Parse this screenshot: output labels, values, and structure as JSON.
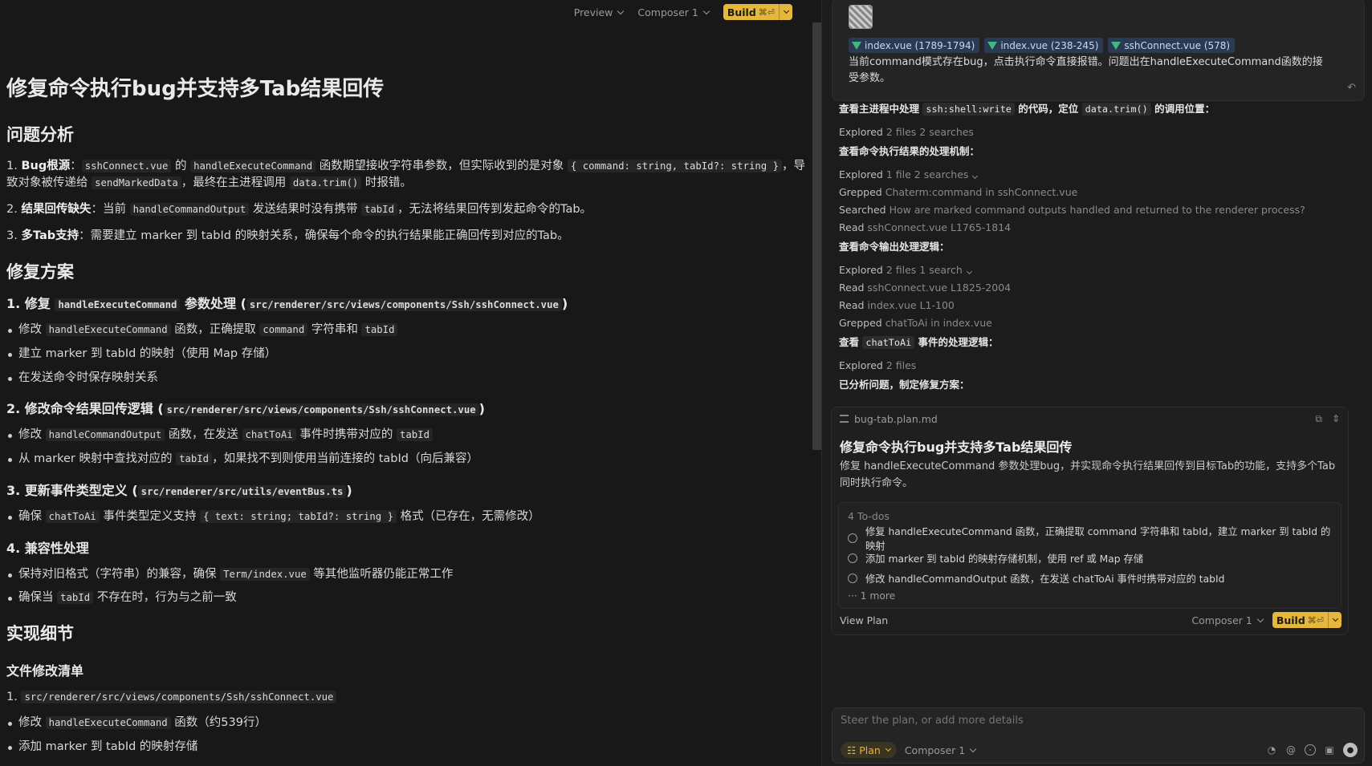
{
  "toolbar": {
    "preview": "Preview",
    "composer": "Composer 1",
    "build": "Build",
    "build_kbd": "⌘⏎"
  },
  "doc": {
    "title": "修复命令执行bug并支持多Tab结果回传",
    "analysis": {
      "heading": "问题分析",
      "items": [
        {
          "n": "1. ",
          "label": "Bug根源",
          "parts": [
            "：",
            "sshConnect.vue",
            " 的 ",
            "handleExecuteCommand",
            " 函数期望接收字符串参数，但实际收到的是对象 ",
            "{ command: string, tabId?: string }",
            "，导致对象被传递给 ",
            "sendMarkedData",
            "，最终在主进程调用 ",
            "data.trim()",
            " 时报错。"
          ]
        },
        {
          "n": "2. ",
          "label": "结果回传缺失",
          "parts": [
            "：当前 ",
            "handleCommandOutput",
            " 发送结果时没有携带 ",
            "tabId",
            "，无法将结果回传到发起命令的Tab。"
          ]
        },
        {
          "n": "3. ",
          "label": "多Tab支持",
          "parts": [
            "：需要建立 marker 到 tabId 的映射关系，确保每个命令的执行结果能正确回传到对应的Tab。"
          ]
        }
      ]
    },
    "plan": {
      "heading": "修复方案",
      "s1": {
        "title": "1. 修复 ",
        "code": "handleExecuteCommand",
        "title2": " 参数处理 (",
        "path": "src/renderer/src/views/components/Ssh/sshConnect.vue",
        "close": ")"
      },
      "s1_items": [
        [
          "修改 ",
          "handleExecuteCommand",
          " 函数，正确提取 ",
          "command",
          " 字符串和 ",
          "tabId",
          ""
        ],
        [
          "建立 marker 到 tabId 的映射（使用 Map 存储）"
        ],
        [
          "在发送命令时保存映射关系"
        ]
      ],
      "s2": {
        "title": "2. 修改命令结果回传逻辑 (",
        "path": "src/renderer/src/views/components/Ssh/sshConnect.vue",
        "close": ")"
      },
      "s2_items": [
        [
          "修改 ",
          "handleCommandOutput",
          " 函数，在发送 ",
          "chatToAi",
          " 事件时携带对应的 ",
          "tabId",
          ""
        ],
        [
          "从 marker 映射中查找对应的 ",
          "tabId",
          "，如果找不到则使用当前连接的 tabId（向后兼容）"
        ]
      ],
      "s3": {
        "title": "3. 更新事件类型定义 (",
        "path": "src/renderer/src/utils/eventBus.ts",
        "close": ")"
      },
      "s3_items": [
        [
          "确保 ",
          "chatToAi",
          " 事件类型定义支持 ",
          "{ text: string; tabId?: string }",
          " 格式（已存在，无需修改）"
        ]
      ],
      "s4": {
        "title": "4. 兼容性处理"
      },
      "s4_items": [
        [
          "保持对旧格式（字符串）的兼容，确保 ",
          "Term/index.vue",
          " 等其他监听器仍能正常工作"
        ],
        [
          "确保当 ",
          "tabId",
          " 不存在时，行为与之前一致"
        ]
      ]
    },
    "impl": {
      "heading": "实现细节",
      "sub": "文件修改清单",
      "file1_n": "1. ",
      "file1": "src/renderer/src/views/components/Ssh/sshConnect.vue",
      "file1_items": [
        [
          "修改 ",
          "handleExecuteCommand",
          " 函数（约539行）"
        ],
        [
          "添加 marker 到 tabId 的映射存储"
        ]
      ]
    }
  },
  "chat": {
    "chips": [
      "index.vue (1789-1794)",
      "index.vue (238-245)",
      "sshConnect.vue (578)"
    ],
    "message": "当前command模式存在bug，点击执行命令直接报错。问题出在handleExecuteCommand函数的接受参数。",
    "log": {
      "h1_pre": "查看主进程中处理 ",
      "h1_code1": "ssh:shell:write",
      "h1_mid": " 的代码，定位 ",
      "h1_code2": "data.trim()",
      "h1_post": " 的调用位置：",
      "r1": {
        "verb": "Explored",
        "text": "2 files 2 searches"
      },
      "h2": "查看命令执行结果的处理机制：",
      "r2": {
        "verb": "Explored",
        "text": "1 file 2 searches"
      },
      "r3": {
        "verb": "Grepped",
        "text": "Chaterm:command in sshConnect.vue"
      },
      "r4": {
        "verb": "Searched",
        "text": "How are marked command outputs handled and returned to the renderer process?"
      },
      "r5": {
        "verb": "Read",
        "text": "sshConnect.vue L1765-1814"
      },
      "h3": "查看命令输出处理逻辑：",
      "r6": {
        "verb": "Explored",
        "text": "2 files 1 search"
      },
      "r7": {
        "verb": "Read",
        "text": "sshConnect.vue L1825-2004"
      },
      "r8": {
        "verb": "Read",
        "text": "index.vue L1-100"
      },
      "r9": {
        "verb": "Grepped",
        "text": "chatToAi in index.vue"
      },
      "h4_pre": "查看 ",
      "h4_code": "chatToAi",
      "h4_post": " 事件的处理逻辑：",
      "r10": {
        "verb": "Explored",
        "text": "2 files"
      },
      "h5": "已分析问题，制定修复方案："
    },
    "plan_card": {
      "file": "bug-tab.plan.md",
      "title": "修复命令执行bug并支持多Tab结果回传",
      "desc": "修复 handleExecuteCommand 参数处理bug，并实现命令执行结果回传到目标Tab的功能，支持多个Tab同时执行命令。",
      "todos_header": "4 To-dos",
      "todos": [
        "修复 handleExecuteCommand 函数，正确提取 command 字符串和 tabId，建立 marker 到 tabId 的映射",
        "添加 marker 到 tabId 的映射存储机制，使用 ref 或 Map 存储",
        "修改 handleCommandOutput 函数，在发送 chatToAi 事件时携带对应的 tabId"
      ],
      "more": "1 more",
      "view_plan": "View Plan",
      "composer": "Composer 1",
      "build": "Build",
      "build_kbd": "⌘⏎"
    },
    "input": {
      "placeholder": "Steer the plan, or add more details",
      "mode": "Plan",
      "composer": "Composer 1"
    }
  },
  "colors": {
    "accent": "#e5b73b",
    "vue": "#41b883",
    "chip_bg": "#2a3a55"
  }
}
